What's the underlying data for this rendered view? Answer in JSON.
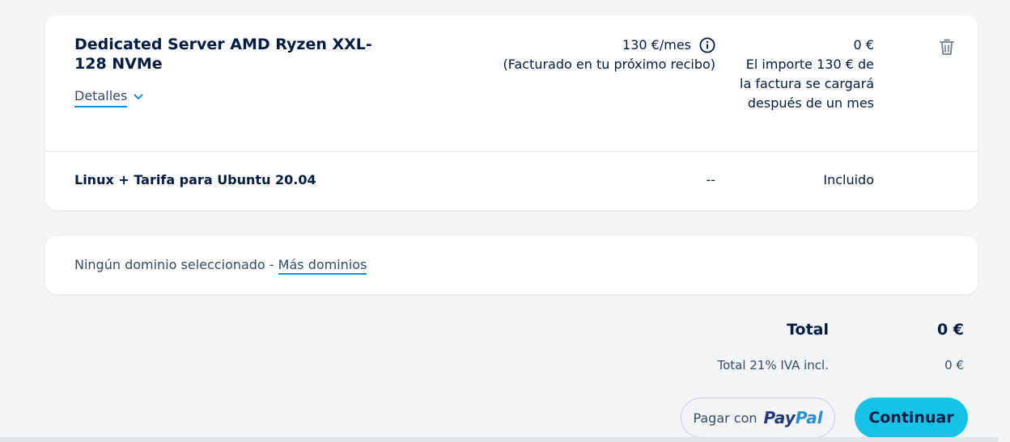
{
  "product": {
    "title": "Dedicated Server AMD Ryzen XXL-128 NVMe",
    "details_label": "Detalles",
    "price": "130 €/mes",
    "price_note": "(Facturado en tu próximo recibo)",
    "amount": "0 €",
    "amount_note": "El importe 130 € de la factura se cargará después de un mes"
  },
  "addon": {
    "name": "Linux + Tarifa para Ubuntu 20.04",
    "price": "--",
    "amount": "Incluido"
  },
  "domain": {
    "text": "Ningún dominio seleccionado - ",
    "link": "Más dominios"
  },
  "summary": {
    "total_label": "Total",
    "total_value": "0 €",
    "vat_label": "Total 21% IVA incl.",
    "vat_value": "0 €"
  },
  "actions": {
    "paypal_prefix": "Pagar con",
    "paypal_pay": "Pay",
    "paypal_pal": "Pal",
    "continue_label": "Continuar"
  },
  "icons": {
    "details": "chevron-down-icon",
    "info": "info-icon",
    "delete": "trash-icon"
  },
  "colors": {
    "accent": "#17c2e9",
    "link_underline": "#1a8fd8",
    "text_primary": "#001b41",
    "page_background": "#f4f5f7"
  }
}
